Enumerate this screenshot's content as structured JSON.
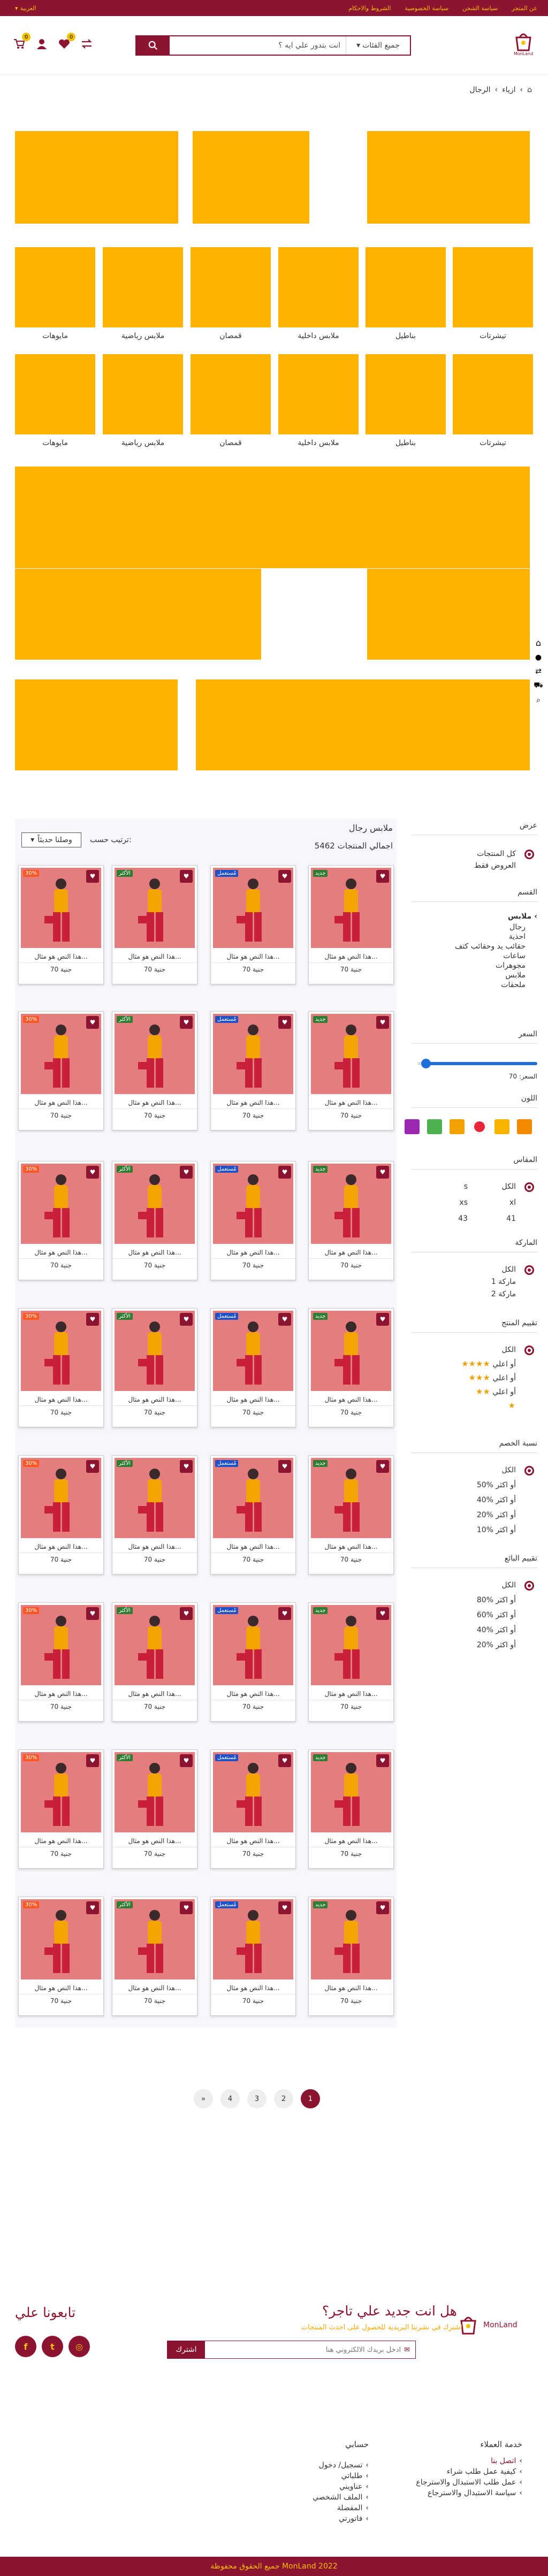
{
  "topbar": {
    "links": [
      "عن المتجر",
      "سياسة الشحن",
      "سياسة الخصوصية",
      "الشروط والاحكام"
    ],
    "language": "العربية"
  },
  "header": {
    "logo_text": "MonLand",
    "search_placeholder": "انت بتدور علي ايه ؟",
    "category_select": "جميع الفئات",
    "cart_count": "0",
    "wishlist_count": "0"
  },
  "breadcrumb": [
    "الرئيسية",
    "ازياء",
    "الرجال"
  ],
  "categories_row1": [
    "تيشرتات",
    "بناطيل",
    "ملابس داخلية",
    "قمصان",
    "ملابس رياضية",
    "مايوهات"
  ],
  "categories_row2": [
    "تيشرتات",
    "بناطيل",
    "ملابس داخلية",
    "قمصان",
    "ملابس رياضية",
    "مايوهات"
  ],
  "listing": {
    "title": "ملابس رجال",
    "count_label": "اجمالي المنتجات",
    "count": "5462",
    "sort_label": "ترتيب حسب:",
    "sort_value": "وصلنا حديثاً"
  },
  "products": {
    "description": "هذا النص هو مثال...",
    "price": "70 جنية",
    "tags": [
      "جديد",
      "مُستعمل",
      "الأكثر",
      "30%"
    ]
  },
  "pagination": [
    "1",
    "2",
    "3",
    "4",
    "»"
  ],
  "sidebar": {
    "view": {
      "title": "عرض",
      "options": [
        "كل المنتجات",
        "العروض فقط"
      ]
    },
    "section": {
      "title": "القسم",
      "parent": "ملابس",
      "items": [
        "رجال",
        "احذية",
        "حقائب يد وحقائب كتف",
        "ساعات",
        "مجوهرات",
        "ملابس",
        "ملحقات"
      ]
    },
    "price": {
      "title": "السعر",
      "label": "السعر: 70",
      "value": 70,
      "max": 1000
    },
    "colors": {
      "title": "اللون",
      "list": [
        "#f28a00",
        "#f6b400",
        "#e8283a",
        "#f3a100",
        "#4caf50",
        "#9c27b0"
      ]
    },
    "size": {
      "title": "المقاس",
      "all": "الكل",
      "options": [
        "s",
        "xl",
        "xs",
        "41",
        "43"
      ]
    },
    "brand": {
      "title": "الماركة",
      "all": "الكل",
      "options": [
        "ماركة 1",
        "ماركة 2"
      ]
    },
    "rating": {
      "title": "تقييم المنتج",
      "all": "الكل",
      "suffix": "أو اعلي"
    },
    "discount": {
      "title": "نسبة الخصم",
      "all": "الكل",
      "options": [
        "50% أو اكثر",
        "40% أو اكثر",
        "20% أو اكثر",
        "10% أو اكثر"
      ]
    },
    "seller": {
      "title": "تقييم البائع",
      "all": "الكل",
      "options": [
        "80% أو اكثر",
        "60% أو اكثر",
        "40% أو اكثر",
        "20% أو اكثر"
      ]
    }
  },
  "newsletter": {
    "title": "هل انت جديد علي تاجر؟",
    "subtitle": "اشترك في نشرتنا البريدية للحصول على احدث المنتجات",
    "placeholder": "ادخل بريدك الالكتروني هنا",
    "button": "اشترك"
  },
  "follow": {
    "title": "تابعونا علي",
    "icons": [
      "instagram-icon",
      "twitter-icon",
      "facebook-icon"
    ]
  },
  "footer": {
    "customer_service_title": "خدمة العملاء",
    "customer_service": [
      "اتصل بنا",
      "كيفية عمل طلب شراء",
      "عمل طلب الاستبدال والاسترجاع",
      "سياسة الاستبدال والاسترجاع"
    ],
    "account_title": "حسابي",
    "account": [
      "تسجيل/ دخول",
      "طلباتي",
      "عناويني",
      "الملف الشخصي",
      "المفضلة",
      "فاتورتي"
    ],
    "copyright": "جميع الحقوق محفوظة MonLand 2022"
  },
  "colors": {
    "brand": "#8c1431",
    "accent": "#ffb300"
  }
}
